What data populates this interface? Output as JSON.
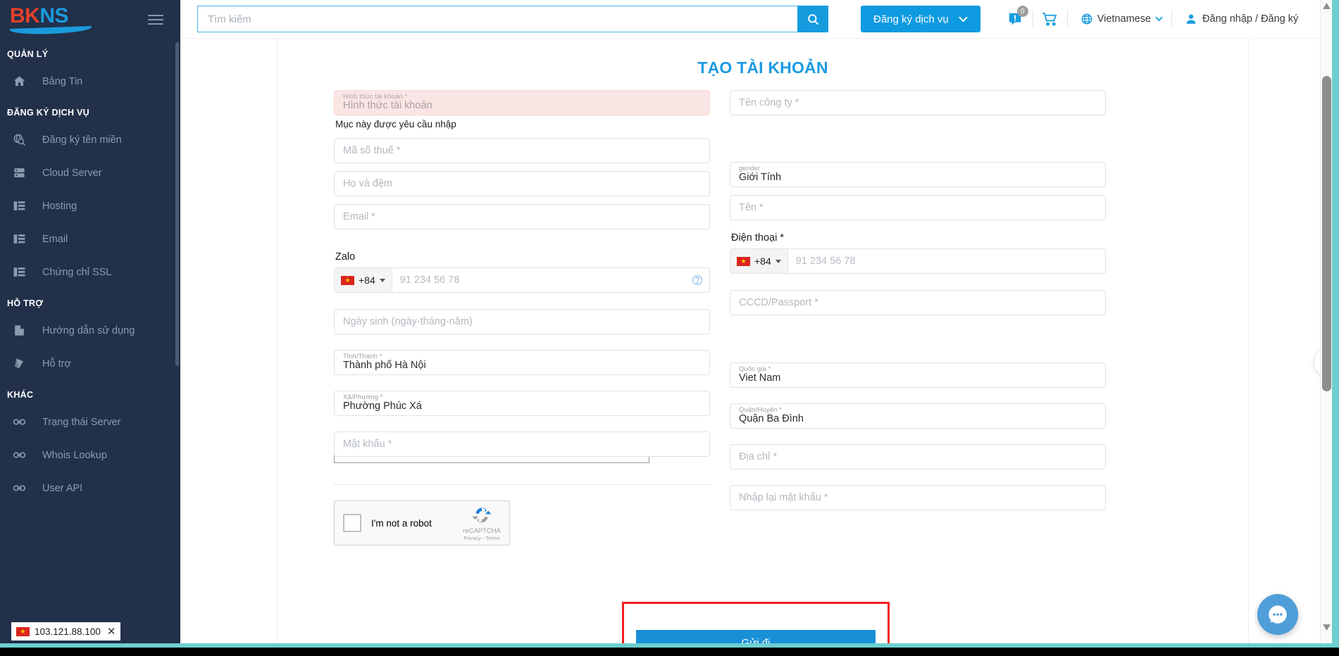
{
  "brand": {
    "name_part1": "BKN",
    "name_part2": "S",
    "name_left": "BK",
    "name_right": "NS"
  },
  "sidebar": {
    "sections": [
      {
        "title": "QUẢN LÝ",
        "items": [
          {
            "label": "Bảng Tin",
            "icon": "home-icon"
          }
        ]
      },
      {
        "title": "ĐĂNG KÝ DỊCH VỤ",
        "items": [
          {
            "label": "Đăng ký tên miền",
            "icon": "domain-search-icon"
          },
          {
            "label": "Cloud Server",
            "icon": "server-icon"
          },
          {
            "label": "Hosting",
            "icon": "list-icon"
          },
          {
            "label": "Email",
            "icon": "list-icon"
          },
          {
            "label": "Chứng chỉ SSL",
            "icon": "list-icon"
          }
        ]
      },
      {
        "title": "HỖ TRỢ",
        "items": [
          {
            "label": "Hướng dẫn sử dụng",
            "icon": "document-icon"
          },
          {
            "label": "Hỗ trợ",
            "icon": "support-icon"
          }
        ]
      },
      {
        "title": "KHÁC",
        "items": [
          {
            "label": "Trạng thái Server",
            "icon": "link-icon"
          },
          {
            "label": "Whois Lookup",
            "icon": "link-icon"
          },
          {
            "label": "User API",
            "icon": "link-icon"
          }
        ]
      }
    ],
    "ip_badge": {
      "ip": "103.121.88.100",
      "close": "✕"
    }
  },
  "header": {
    "search_placeholder": "Tìm kiếm",
    "search_value": "",
    "register_service_label": "Đăng ký dịch vụ",
    "notification_count": "0",
    "language": "Vietnamese",
    "account_label": "Đăng nhập / Đăng ký"
  },
  "form": {
    "title": "TẠO TÀI KHOẢN",
    "left": {
      "account_type": {
        "label": "Hình thức tài khoản *",
        "placeholder": "Hình thức tài khoản",
        "error": "Mục này được yêu cầu nhập"
      },
      "tax_code": {
        "placeholder": "Mã số thuế *"
      },
      "last_name": {
        "placeholder": "Họ và đệm"
      },
      "email": {
        "placeholder": "Email *"
      },
      "zalo_label": "Zalo",
      "zalo_phone": {
        "country_code": "+84",
        "placeholder": "91 234 56 78"
      },
      "birthday": {
        "placeholder": "Ngày sinh (ngày-tháng-năm)"
      },
      "province": {
        "label": "Tỉnh/Thành *",
        "value": "Thành phố Hà Nội"
      },
      "ward": {
        "label": "Xã/Phường *",
        "value": "Phường Phúc Xá"
      },
      "password": {
        "placeholder": "Mật khẩu *"
      }
    },
    "right": {
      "company": {
        "placeholder": "Tên công ty *"
      },
      "gender": {
        "label": "gender",
        "value": "Giới Tính"
      },
      "first_name": {
        "placeholder": "Tên *"
      },
      "phone_label": "Điện thoại *",
      "phone": {
        "country_code": "+84",
        "placeholder": "91 234 56 78"
      },
      "id_card": {
        "placeholder": "CCCD/Passport *"
      },
      "country": {
        "label": "Quốc gia *",
        "value": "Viet Nam"
      },
      "district": {
        "label": "Quận/Huyện *",
        "value": "Quận Ba Đình"
      },
      "address": {
        "placeholder": "Địa chỉ *"
      },
      "password_confirm": {
        "placeholder": "Nhập lại mật khẩu *"
      }
    },
    "recaptcha": {
      "label": "I'm not a robot",
      "brand": "reCAPTCHA",
      "terms": "Privacy - Terms"
    },
    "submit_label": "Gửi đi"
  },
  "colors": {
    "accent": "#1b9ae1",
    "sidebar_bg": "#22304a",
    "error_bg": "#fbe4e4",
    "highlight": "#f41e1e",
    "teal": "#6dcfd0"
  }
}
